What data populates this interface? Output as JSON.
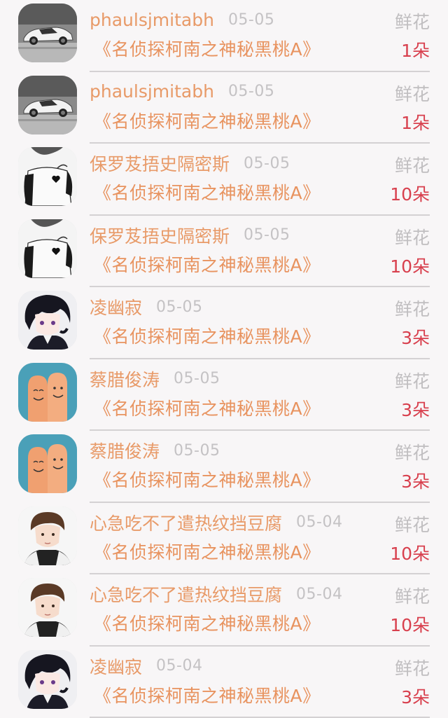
{
  "gift_records": [
    {
      "name": "phaulsjmitabh",
      "date": "05-05",
      "gift": "鲜花",
      "title": "《名侦探柯南之神秘黑桃A》",
      "count": "1朵",
      "avatar": "car"
    },
    {
      "name": "phaulsjmitabh",
      "date": "05-05",
      "gift": "鲜花",
      "title": "《名侦探柯南之神秘黑桃A》",
      "count": "1朵",
      "avatar": "car"
    },
    {
      "name": "保罗芨捂史隔密斯",
      "date": "05-05",
      "gift": "鲜花",
      "title": "《名侦探柯南之神秘黑桃A》",
      "count": "10朵",
      "avatar": "sketch"
    },
    {
      "name": "保罗芨捂史隔密斯",
      "date": "05-05",
      "gift": "鲜花",
      "title": "《名侦探柯南之神秘黑桃A》",
      "count": "10朵",
      "avatar": "sketch"
    },
    {
      "name": "凌幽寂",
      "date": "05-05",
      "gift": "鲜花",
      "title": "《名侦探柯南之神秘黑桃A》",
      "count": "3朵",
      "avatar": "anime"
    },
    {
      "name": "蔡腊俊涛",
      "date": "05-05",
      "gift": "鲜花",
      "title": "《名侦探柯南之神秘黑桃A》",
      "count": "3朵",
      "avatar": "fingers"
    },
    {
      "name": "蔡腊俊涛",
      "date": "05-05",
      "gift": "鲜花",
      "title": "《名侦探柯南之神秘黑桃A》",
      "count": "3朵",
      "avatar": "fingers"
    },
    {
      "name": "心急吃不了遣热纹挡豆腐",
      "date": "05-04",
      "gift": "鲜花",
      "title": "《名侦探柯南之神秘黑桃A》",
      "count": "10朵",
      "avatar": "boy"
    },
    {
      "name": "心急吃不了遣热纹挡豆腐",
      "date": "05-04",
      "gift": "鲜花",
      "title": "《名侦探柯南之神秘黑桃A》",
      "count": "10朵",
      "avatar": "boy"
    },
    {
      "name": "凌幽寂",
      "date": "05-04",
      "gift": "鲜花",
      "title": "《名侦探柯南之神秘黑桃A》",
      "count": "3朵",
      "avatar": "anime"
    }
  ],
  "colors": {
    "name": "#e89a68",
    "date": "#c4c2c4",
    "gift": "#c0bec0",
    "title": "#e8935f",
    "count": "#d8404e",
    "background": "#f8f6f7",
    "divider": "#d4d1d3"
  }
}
